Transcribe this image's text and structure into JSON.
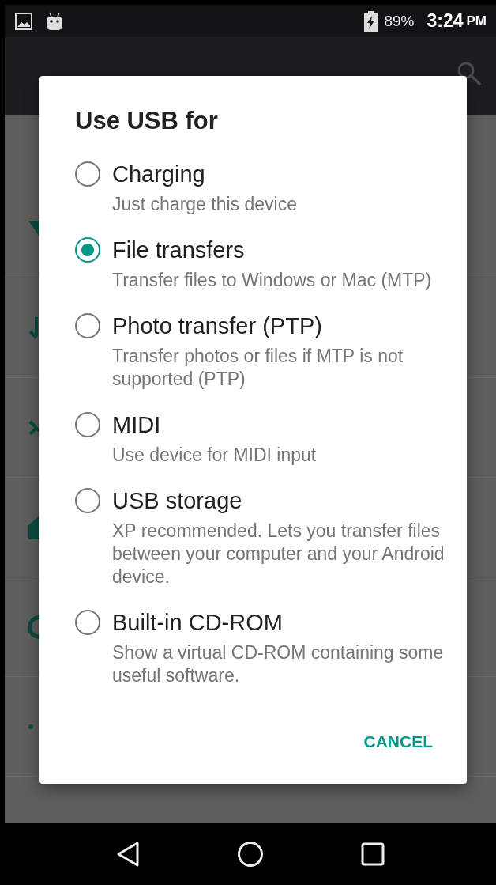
{
  "status_bar": {
    "battery": "89%",
    "time": "3:24",
    "time_suffix": "PM"
  },
  "dialog": {
    "title": "Use USB for",
    "options": [
      {
        "label": "Charging",
        "description": "Just charge this device",
        "selected": false
      },
      {
        "label": "File transfers",
        "description": "Transfer files to Windows or Mac (MTP)",
        "selected": true
      },
      {
        "label": "Photo transfer (PTP)",
        "description": "Transfer photos or files if MTP is not supported (PTP)",
        "selected": false
      },
      {
        "label": "MIDI",
        "description": "Use device for MIDI input",
        "selected": false
      },
      {
        "label": "USB storage",
        "description": "XP recommended. Lets you transfer files between your computer and your Android device.",
        "selected": false
      },
      {
        "label": "Built-in CD-ROM",
        "description": "Show a virtual CD-ROM containing some useful software.",
        "selected": false
      }
    ],
    "buttons": [
      "CANCEL"
    ]
  }
}
